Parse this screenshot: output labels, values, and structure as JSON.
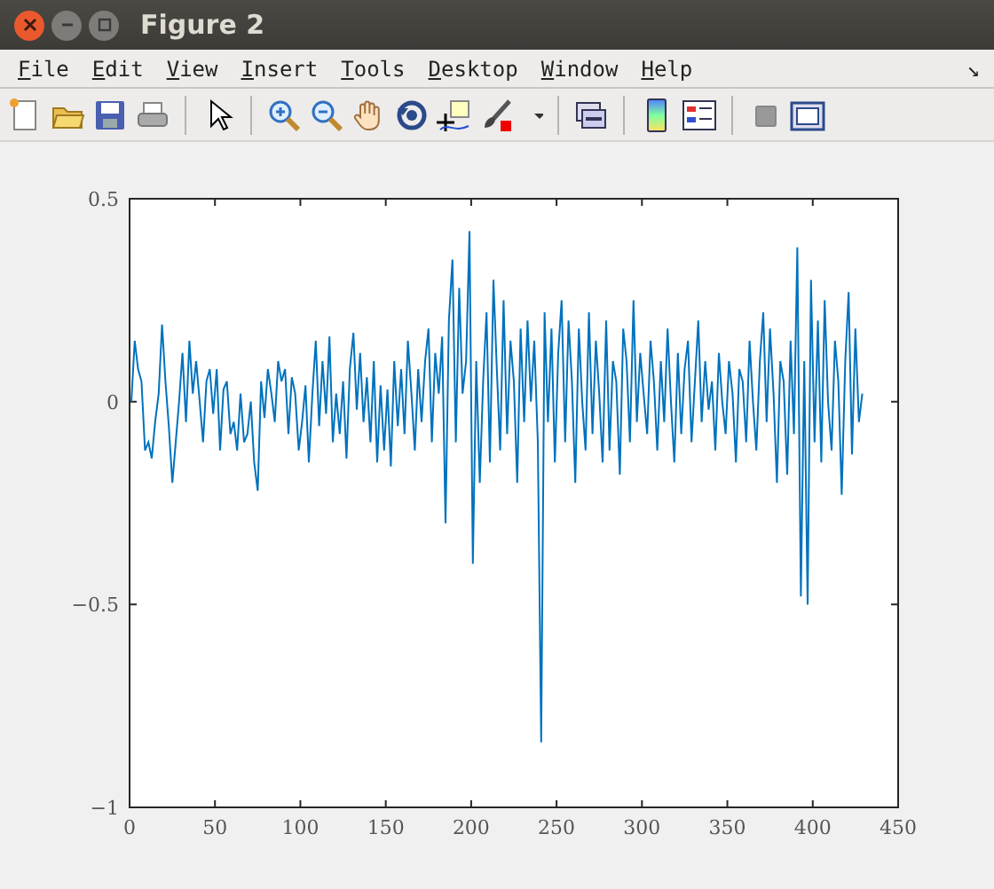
{
  "window": {
    "title": "Figure 2"
  },
  "menu": [
    "File",
    "Edit",
    "View",
    "Insert",
    "Tools",
    "Desktop",
    "Window",
    "Help"
  ],
  "dock_glyph": "↘",
  "axes": {
    "chart_data": {
      "type": "line",
      "xlim": [
        0,
        450
      ],
      "ylim": [
        -1,
        0.5
      ],
      "xticks": [
        0,
        50,
        100,
        150,
        200,
        250,
        300,
        350,
        400,
        450
      ],
      "yticks": [
        {
          "value": -1,
          "label": "−1"
        },
        {
          "value": -0.5,
          "label": "−0.5"
        },
        0,
        0.5
      ],
      "x": [
        1,
        3,
        5,
        7,
        9,
        11,
        13,
        15,
        17,
        19,
        21,
        23,
        25,
        27,
        29,
        31,
        33,
        35,
        37,
        39,
        41,
        43,
        45,
        47,
        49,
        51,
        53,
        55,
        57,
        59,
        61,
        63,
        65,
        67,
        69,
        71,
        73,
        75,
        77,
        79,
        81,
        83,
        85,
        87,
        89,
        91,
        93,
        95,
        97,
        99,
        101,
        103,
        105,
        107,
        109,
        111,
        113,
        115,
        117,
        119,
        121,
        123,
        125,
        127,
        129,
        131,
        133,
        135,
        137,
        139,
        141,
        143,
        145,
        147,
        149,
        151,
        153,
        155,
        157,
        159,
        161,
        163,
        165,
        167,
        169,
        171,
        173,
        175,
        177,
        179,
        181,
        183,
        185,
        187,
        189,
        191,
        193,
        195,
        197,
        199,
        201,
        203,
        205,
        207,
        209,
        211,
        213,
        215,
        217,
        219,
        221,
        223,
        225,
        227,
        229,
        231,
        233,
        235,
        237,
        239,
        241,
        243,
        245,
        247,
        249,
        251,
        253,
        255,
        257,
        259,
        261,
        263,
        265,
        267,
        269,
        271,
        273,
        275,
        277,
        279,
        281,
        283,
        285,
        287,
        289,
        291,
        293,
        295,
        297,
        299,
        301,
        303,
        305,
        307,
        309,
        311,
        313,
        315,
        317,
        319,
        321,
        323,
        325,
        327,
        329,
        331,
        333,
        335,
        337,
        339,
        341,
        343,
        345,
        347,
        349,
        351,
        353,
        355,
        357,
        359,
        361,
        363,
        365,
        367,
        369,
        371,
        373,
        375,
        377,
        379,
        381,
        383,
        385,
        387,
        389,
        391,
        393,
        395,
        397,
        399,
        401,
        403,
        405,
        407,
        409,
        411,
        413,
        415,
        417,
        419,
        421,
        423,
        425,
        427,
        429
      ],
      "series": [
        {
          "color": "#0072bd",
          "values": [
            0.0,
            0.15,
            0.08,
            0.05,
            -0.12,
            -0.1,
            -0.14,
            -0.05,
            0.02,
            0.19,
            0.05,
            -0.06,
            -0.2,
            -0.1,
            0.0,
            0.12,
            -0.05,
            0.15,
            0.02,
            0.1,
            0.0,
            -0.1,
            0.05,
            0.08,
            -0.03,
            0.08,
            -0.12,
            0.03,
            0.05,
            -0.08,
            -0.05,
            -0.12,
            0.02,
            -0.1,
            -0.08,
            0.0,
            -0.15,
            -0.22,
            0.05,
            -0.04,
            0.08,
            0.02,
            -0.05,
            0.1,
            0.05,
            0.08,
            -0.08,
            0.06,
            0.02,
            -0.12,
            -0.05,
            0.04,
            -0.15,
            0.02,
            0.15,
            -0.06,
            0.1,
            -0.03,
            0.16,
            -0.1,
            0.02,
            -0.08,
            0.05,
            -0.14,
            0.08,
            0.17,
            -0.02,
            0.12,
            -0.05,
            0.06,
            -0.1,
            0.1,
            -0.15,
            0.04,
            -0.12,
            0.03,
            -0.16,
            0.1,
            -0.06,
            0.08,
            -0.08,
            0.15,
            0.02,
            -0.12,
            0.08,
            -0.05,
            0.1,
            0.18,
            -0.1,
            0.12,
            0.02,
            0.16,
            -0.3,
            0.2,
            0.35,
            -0.1,
            0.28,
            0.02,
            0.1,
            0.42,
            -0.4,
            0.1,
            -0.2,
            0.05,
            0.22,
            -0.15,
            0.3,
            0.08,
            -0.12,
            0.25,
            -0.08,
            0.15,
            0.05,
            -0.2,
            0.18,
            -0.05,
            0.2,
            0.0,
            0.15,
            -0.1,
            -0.84,
            0.22,
            -0.05,
            0.18,
            -0.15,
            0.12,
            0.25,
            -0.1,
            0.2,
            0.05,
            -0.2,
            0.18,
            0.0,
            -0.12,
            0.22,
            -0.08,
            0.15,
            0.02,
            -0.15,
            0.2,
            -0.12,
            0.1,
            0.05,
            -0.18,
            0.18,
            0.1,
            -0.1,
            0.25,
            -0.05,
            0.12,
            0.02,
            -0.08,
            0.15,
            0.05,
            -0.12,
            0.1,
            -0.05,
            0.18,
            0.0,
            -0.15,
            0.12,
            -0.08,
            0.08,
            0.15,
            -0.1,
            0.05,
            0.2,
            -0.05,
            0.1,
            -0.02,
            0.05,
            -0.12,
            0.12,
            0.0,
            -0.08,
            0.1,
            0.02,
            -0.15,
            0.08,
            0.05,
            -0.1,
            0.15,
            0.0,
            -0.12,
            0.1,
            0.22,
            -0.05,
            0.18,
            0.02,
            -0.2,
            0.1,
            0.05,
            -0.18,
            0.15,
            -0.08,
            0.38,
            -0.48,
            0.1,
            -0.5,
            0.3,
            -0.1,
            0.2,
            -0.15,
            0.25,
            0.0,
            -0.12,
            0.15,
            0.05,
            -0.23,
            0.1,
            0.27,
            -0.13,
            0.18,
            -0.05,
            0.02
          ]
        }
      ]
    }
  }
}
